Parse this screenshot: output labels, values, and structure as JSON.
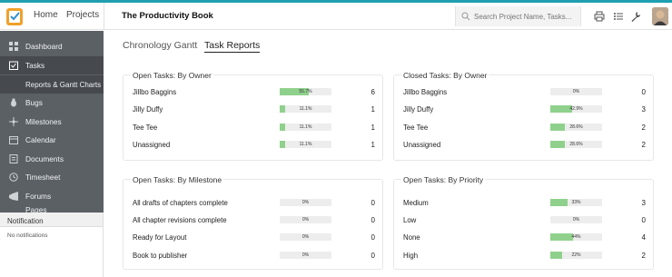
{
  "header": {
    "nav": [
      "Home",
      "Projects"
    ],
    "project_title": "The Productivity Book",
    "search_placeholder": "Search Project Name, Tasks..."
  },
  "sidebar": {
    "items": [
      {
        "label": "Dashboard",
        "icon": "dashboard-icon"
      },
      {
        "label": "Tasks",
        "icon": "tasks-icon"
      },
      {
        "label": "Reports & Gantt Charts",
        "icon": ""
      },
      {
        "label": "Bugs",
        "icon": "bug-icon"
      },
      {
        "label": "Milestones",
        "icon": "milestone-icon"
      },
      {
        "label": "Calendar",
        "icon": "calendar-icon"
      },
      {
        "label": "Documents",
        "icon": "documents-icon"
      },
      {
        "label": "Timesheet",
        "icon": "timesheet-icon"
      },
      {
        "label": "Forums",
        "icon": "forums-icon"
      },
      {
        "label": "Pages",
        "icon": "pages-icon"
      }
    ]
  },
  "notification": {
    "title": "Notification",
    "body": "No notifications"
  },
  "tabs": [
    "Chronology Gantt",
    "Task Reports"
  ],
  "cards": [
    {
      "title": "Open Tasks: By Owner",
      "rows": [
        {
          "name": "Jillbo Baggins",
          "pct": "55.7%",
          "fill": 0.557,
          "count": "6"
        },
        {
          "name": "Jilly Duffy",
          "pct": "11.1%",
          "fill": 0.111,
          "count": "1"
        },
        {
          "name": "Tee Tee",
          "pct": "11.1%",
          "fill": 0.111,
          "count": "1"
        },
        {
          "name": "Unassigned",
          "pct": "11.1%",
          "fill": 0.111,
          "count": "1"
        }
      ]
    },
    {
      "title": "Closed Tasks: By Owner",
      "rows": [
        {
          "name": "Jillbo Baggins",
          "pct": "0%",
          "fill": 0,
          "count": "0"
        },
        {
          "name": "Jilly Duffy",
          "pct": "42.9%",
          "fill": 0.429,
          "count": "3"
        },
        {
          "name": "Tee Tee",
          "pct": "28.6%",
          "fill": 0.286,
          "count": "2"
        },
        {
          "name": "Unassigned",
          "pct": "28.6%",
          "fill": 0.286,
          "count": "2"
        }
      ]
    },
    {
      "title": "Open Tasks: By Milestone",
      "rows": [
        {
          "name": "All drafts of chapters complete",
          "pct": "0%",
          "fill": 0,
          "count": "0"
        },
        {
          "name": "All chapter revisions complete",
          "pct": "0%",
          "fill": 0,
          "count": "0"
        },
        {
          "name": "Ready for Layout",
          "pct": "0%",
          "fill": 0,
          "count": "0"
        },
        {
          "name": "Book to publisher",
          "pct": "0%",
          "fill": 0,
          "count": "0"
        }
      ]
    },
    {
      "title": "Open Tasks: By Priority",
      "rows": [
        {
          "name": "Medium",
          "pct": "33%",
          "fill": 0.33,
          "count": "3"
        },
        {
          "name": "Low",
          "pct": "0%",
          "fill": 0,
          "count": "0"
        },
        {
          "name": "None",
          "pct": "44%",
          "fill": 0.44,
          "count": "4"
        },
        {
          "name": "High",
          "pct": "22%",
          "fill": 0.22,
          "count": "2"
        }
      ]
    }
  ],
  "colors": {
    "bar_fill": "#8fd18c",
    "sidebar_bg": "#5b6065",
    "accent": "#1f9fb1"
  }
}
